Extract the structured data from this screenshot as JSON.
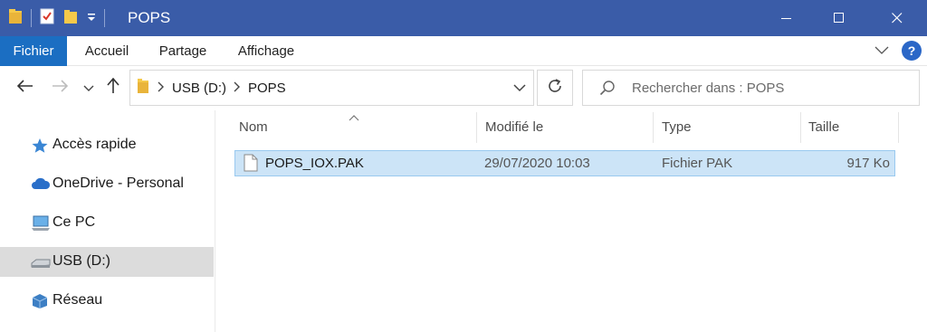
{
  "window": {
    "title": "POPS",
    "controls": {
      "minimize_icon": "minimize-icon",
      "maximize_icon": "maximize-icon",
      "close_icon": "close-icon"
    }
  },
  "quick_access_toolbar": [
    "folder-icon",
    "properties-icon",
    "new-folder-icon",
    "customize-dropdown-icon"
  ],
  "ribbon": {
    "tabs": [
      {
        "label": "Fichier",
        "active": true
      },
      {
        "label": "Accueil"
      },
      {
        "label": "Partage"
      },
      {
        "label": "Affichage"
      }
    ],
    "help_label": "?"
  },
  "address": {
    "crumbs": [
      "USB (D:)",
      "POPS"
    ]
  },
  "search": {
    "placeholder": "Rechercher dans : POPS"
  },
  "sidebar": {
    "items": [
      {
        "label": "Accès rapide",
        "icon": "star-icon"
      },
      {
        "label": "OneDrive - Personal",
        "icon": "cloud-icon"
      },
      {
        "label": "Ce PC",
        "icon": "computer-icon"
      },
      {
        "label": "USB (D:)",
        "icon": "drive-icon",
        "selected": true
      },
      {
        "label": "Réseau",
        "icon": "network-icon"
      }
    ]
  },
  "file_list": {
    "columns": [
      "Nom",
      "Modifié le",
      "Type",
      "Taille"
    ],
    "rows": [
      {
        "name": "POPS_IOX.PAK",
        "modified": "29/07/2020 10:03",
        "type": "Fichier PAK",
        "size": "917 Ko",
        "selected": true
      }
    ]
  },
  "colors": {
    "titlebar": "#3a5ca8",
    "file_tab": "#1b6ec2",
    "selection": "#cce4f7",
    "selection_border": "#99c9ef",
    "sidebar_selected": "#dcdcdc"
  }
}
